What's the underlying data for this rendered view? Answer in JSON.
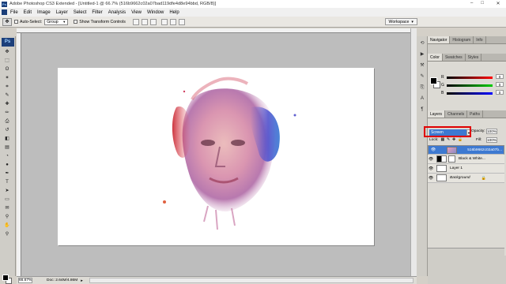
{
  "window": {
    "title": "Adobe Photoshop CS3 Extended - [Untitled-1 @ 66.7% (516b9662c02a07bad119dfe4d8e94bbd, RGB/8)]",
    "minimize": "–",
    "maximize": "□",
    "close": "✕"
  },
  "menu": {
    "app_icon_label": "Ps",
    "items": [
      "File",
      "Edit",
      "Image",
      "Layer",
      "Select",
      "Filter",
      "Analysis",
      "View",
      "Window",
      "Help"
    ]
  },
  "options": {
    "auto_select_label": "Auto-Select:",
    "auto_select_value": "Group",
    "transform_label": "Show Transform Controls",
    "workspace_label": "Workspace"
  },
  "toolbox": {
    "logo": "Ps",
    "tools": [
      "move-icon",
      "marquee-icon",
      "lasso-icon",
      "magic-wand-icon",
      "crop-icon",
      "slice-icon",
      "healing-icon",
      "brush-icon",
      "clone-icon",
      "history-brush-icon",
      "eraser-icon",
      "gradient-icon",
      "blur-icon",
      "dodge-icon",
      "pen-icon",
      "type-icon",
      "path-select-icon",
      "shape-icon",
      "notes-icon",
      "eyedropper-icon",
      "hand-icon",
      "zoom-icon"
    ],
    "glyphs": [
      "✥",
      "⬚",
      "ʘ",
      "✶",
      "⌗",
      "✎",
      "✚",
      "✏",
      "⎙",
      "↺",
      "◧",
      "▤",
      "◔",
      "●",
      "✒",
      "T",
      "➤",
      "▭",
      "✉",
      "⚲",
      "✋",
      "🔍"
    ]
  },
  "status": {
    "zoom": "66.67%",
    "doc": "Doc: 2.64M/4.86M"
  },
  "panels": {
    "tabs_top": [
      "Navigator",
      "Histogram",
      "Info"
    ],
    "color_tab": "Color",
    "swatches_tab": "Swatches",
    "styles_tab": "Styles",
    "channels": [
      {
        "label": "R",
        "value": "0"
      },
      {
        "label": "G",
        "value": "0"
      },
      {
        "label": "B",
        "value": "0"
      }
    ],
    "layers_tab": "Layers",
    "channels_tab": "Channels",
    "paths_tab": "Paths",
    "blend_mode": "Screen",
    "opacity_label": "Opacity:",
    "opacity_value": "100%",
    "lock_label": "Lock:",
    "fill_label": "Fill:",
    "fill_value": "100%",
    "layers": [
      {
        "name": "516b9662c02a07b...",
        "type": "face",
        "selected": true
      },
      {
        "name": "Black & White...",
        "type": "adjustment",
        "selected": false
      },
      {
        "name": "Layer 1",
        "type": "white",
        "selected": false
      },
      {
        "name": "Background",
        "type": "white",
        "selected": false
      }
    ]
  },
  "colors": {
    "accent": "#3d79d1",
    "highlight_box": "#e00000",
    "canvas": "#ffffff",
    "workspace": "#bdbdbd"
  }
}
